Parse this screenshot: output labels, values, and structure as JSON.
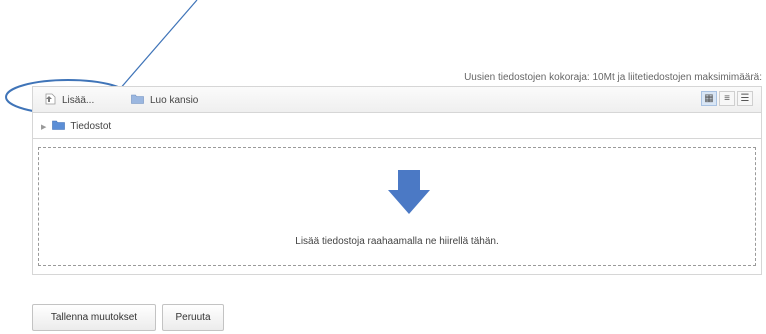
{
  "upload_limit_text": "Uusien tiedostojen kokoraja: 10Mt ja liitetiedostojen maksimimäärä:",
  "toolbar": {
    "add_label": "Lisää...",
    "create_folder_label": "Luo kansio",
    "view_modes": [
      "icons-view",
      "list-view",
      "tree-view"
    ],
    "active_view": "icons-view"
  },
  "path": {
    "folder_label": "Tiedostot"
  },
  "dropzone": {
    "text": "Lisää tiedostoja raahaamalla ne hiirellä tähän."
  },
  "buttons": {
    "save_label": "Tallenna muutokset",
    "cancel_label": "Peruuta"
  },
  "colors": {
    "annotation": "#3f74b8",
    "drop_arrow": "#4b79c5",
    "folder": "#5b8ed6"
  }
}
